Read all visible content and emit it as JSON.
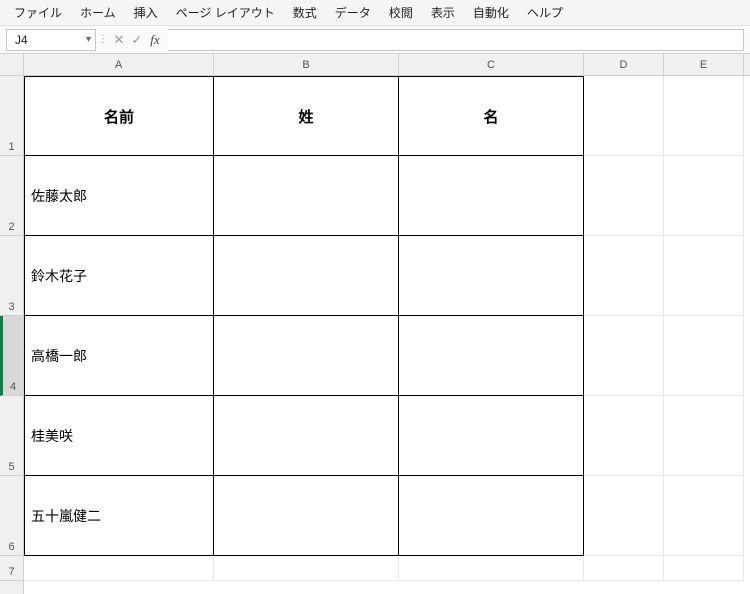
{
  "menu": {
    "file": "ファイル",
    "home": "ホーム",
    "insert": "挿入",
    "page_layout": "ページ レイアウト",
    "formulas": "数式",
    "data": "データ",
    "review": "校閲",
    "view": "表示",
    "automate": "自動化",
    "help": "ヘルプ"
  },
  "formula_bar": {
    "cell_ref": "J4",
    "fx": "fx",
    "value": ""
  },
  "columns": {
    "A": "A",
    "B": "B",
    "C": "C",
    "D": "D",
    "E": "E"
  },
  "rows": {
    "1": "1",
    "2": "2",
    "3": "3",
    "4": "4",
    "5": "5",
    "6": "6",
    "7": "7"
  },
  "table": {
    "headers": {
      "name": "名前",
      "last": "姓",
      "first": "名"
    },
    "data": [
      {
        "name": "佐藤太郎",
        "last": "",
        "first": ""
      },
      {
        "name": "鈴木花子",
        "last": "",
        "first": ""
      },
      {
        "name": "高橋一郎",
        "last": "",
        "first": ""
      },
      {
        "name": "桂美咲",
        "last": "",
        "first": ""
      },
      {
        "name": "五十嵐健二",
        "last": "",
        "first": ""
      }
    ]
  },
  "layout": {
    "col_widths": {
      "A": 190,
      "B": 185,
      "C": 185,
      "D": 80,
      "E": 80
    },
    "row_heights": {
      "header": 80,
      "data": 80,
      "last_vis": 25
    }
  }
}
